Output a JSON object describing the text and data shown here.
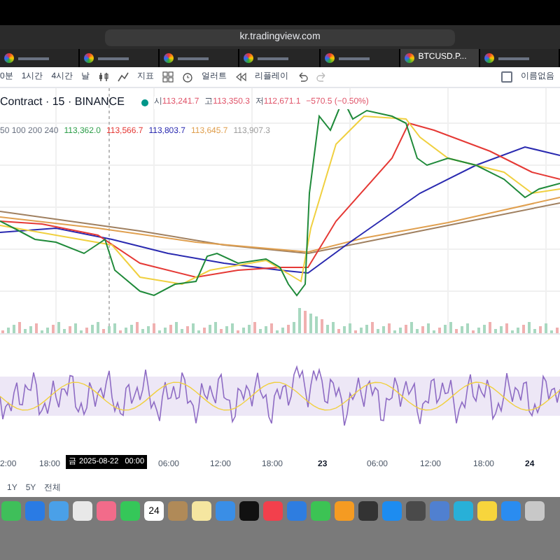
{
  "browser": {
    "url": "kr.tradingview.com",
    "tabs": [
      {
        "selected": false
      },
      {
        "selected": false
      },
      {
        "selected": false
      },
      {
        "selected": false
      },
      {
        "selected": false
      },
      {
        "label": "BTCUSD.P...",
        "selected": true
      },
      {
        "selected": false
      }
    ]
  },
  "toolbar": {
    "intervals": [
      {
        "label": "0분",
        "selected": false
      },
      {
        "label": "1시간",
        "selected": false
      },
      {
        "label": "4시간",
        "selected": false
      },
      {
        "label": "날",
        "selected": false
      }
    ],
    "indicators": "지표",
    "alert": "얼러트",
    "replay": "리플레이",
    "layout_checked": false,
    "layout_name": "이름없음"
  },
  "legend": {
    "symbol": "Contract · 15 · BINANCE",
    "values": [
      {
        "label": "시",
        "value": "113,241.7"
      },
      {
        "label": "고",
        "value": "113,350.3"
      },
      {
        "label": "저",
        "value": "112,671.1"
      }
    ],
    "change": "−570.5 (−0.50%)"
  },
  "ma_legend": {
    "lengths": "50 100 200 240",
    "values": [
      {
        "value": "113,362.0",
        "color": "#2e9e4a"
      },
      {
        "value": "113,566.7",
        "color": "#e53935"
      },
      {
        "value": "113,803.7",
        "color": "#2a2ab0"
      },
      {
        "value": "113,645.7",
        "color": "#e0a050"
      },
      {
        "value": "113,907.3",
        "color": "#9e9e9e"
      }
    ]
  },
  "time_axis": {
    "labels": [
      "2:00",
      "18:00",
      "06:00",
      "12:00",
      "18:00",
      "23",
      "06:00",
      "12:00",
      "18:00",
      "24"
    ],
    "cursor_label": "금 2025-08-22   00:00"
  },
  "ranges": [
    "1Y",
    "5Y",
    "전체"
  ],
  "dock": {
    "calendar_day": "24"
  }
}
